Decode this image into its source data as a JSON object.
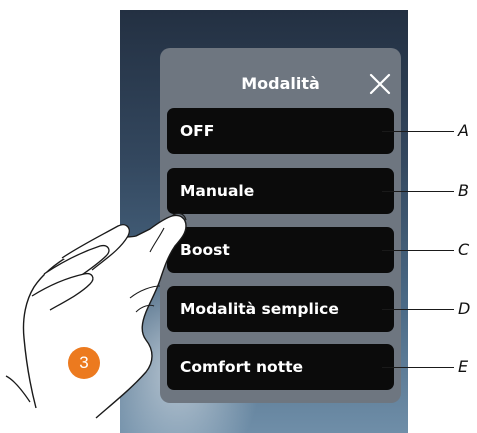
{
  "dialog": {
    "title": "Modalità",
    "close_icon": "close-icon"
  },
  "modes": [
    {
      "label": "OFF",
      "callout": "A"
    },
    {
      "label": "Manuale",
      "callout": "B"
    },
    {
      "label": "Boost",
      "callout": "C"
    },
    {
      "label": "Modalità semplice",
      "callout": "D"
    },
    {
      "label": "Comfort notte",
      "callout": "E"
    }
  ],
  "step": {
    "number": "3",
    "color": "#ec7a1f"
  },
  "icons": {
    "hand": "pointing-hand-icon"
  }
}
